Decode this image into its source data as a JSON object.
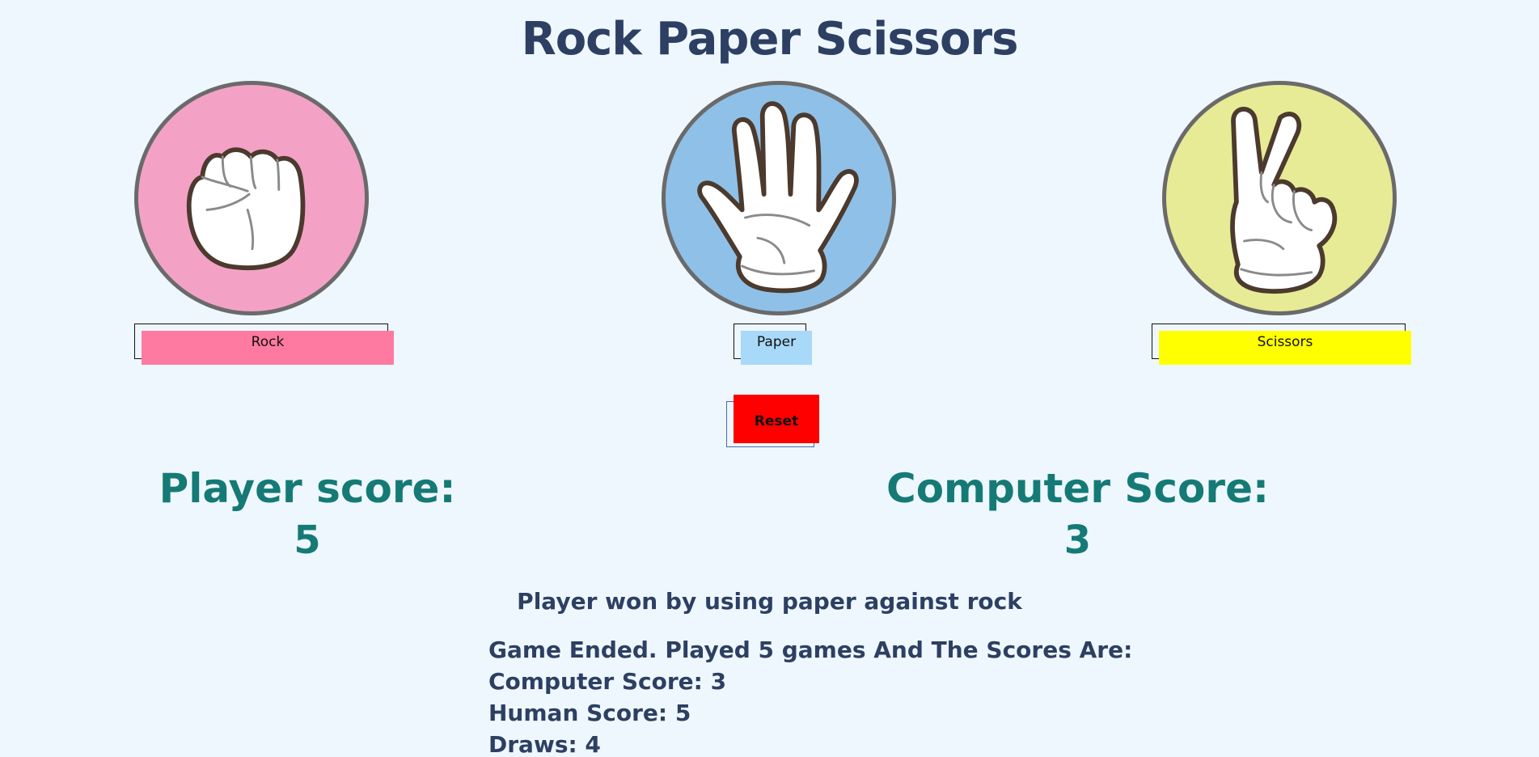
{
  "title": "Rock Paper Scissors",
  "choices": [
    {
      "id": "rock",
      "icon": "rock-fist-icon",
      "label": "Rock",
      "color": "#f3a2c6",
      "button_color": "#ff7aa0"
    },
    {
      "id": "paper",
      "icon": "paper-open-hand-icon",
      "label": "Paper",
      "color": "#8fc0e8",
      "button_color": "#a8d9f8"
    },
    {
      "id": "scissors",
      "icon": "scissors-peace-hand-icon",
      "label": "Scissors",
      "color": "#e7eb96",
      "button_color": "#ffff00"
    }
  ],
  "reset": {
    "label": "Reset",
    "color": "#ff0000"
  },
  "scores": {
    "player_label": "Player score:",
    "player_value": "5",
    "computer_label": "Computer Score:",
    "computer_value": "3"
  },
  "result_message": "Player won by using paper against rock",
  "summary": {
    "line1": "Game Ended. Played 5 games And The Scores Are:",
    "line2": "Computer Score: 3",
    "line3": "Human Score: 5",
    "line4": "Draws: 4"
  }
}
